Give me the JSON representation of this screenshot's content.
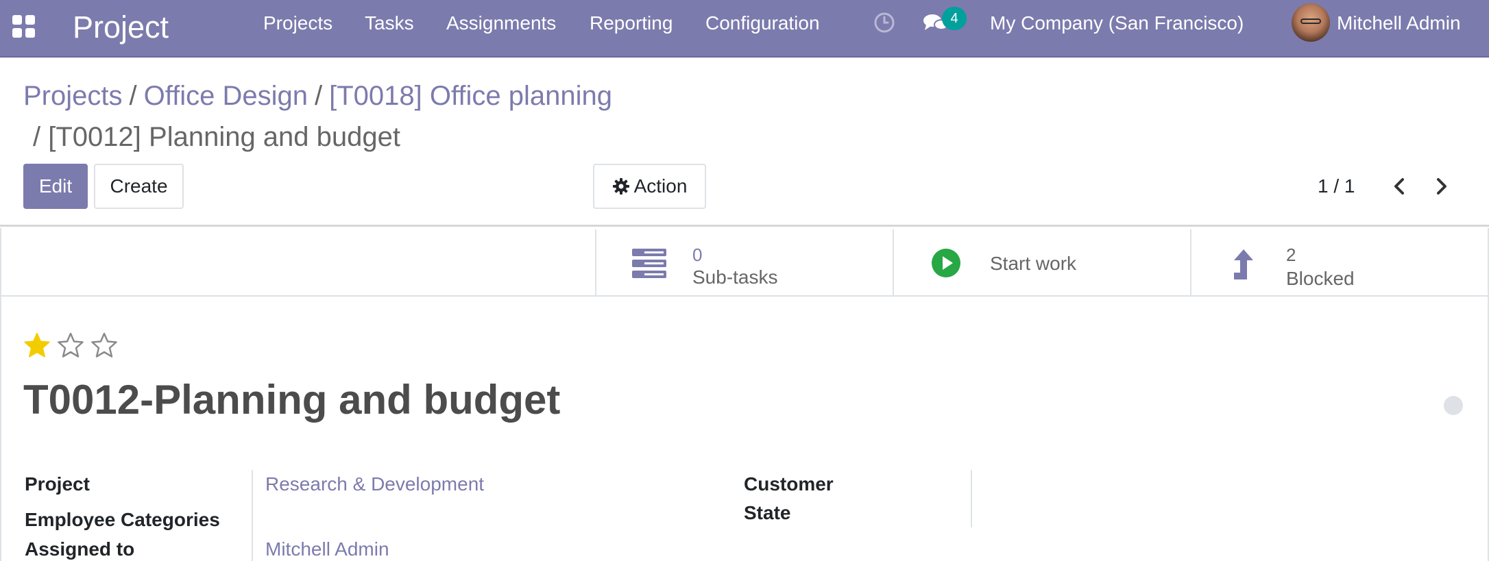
{
  "navbar": {
    "app_title": "Project",
    "menu": [
      "Projects",
      "Tasks",
      "Assignments",
      "Reporting",
      "Configuration"
    ],
    "messages_count": "4",
    "company": "My Company (San Francisco)",
    "user": "Mitchell Admin",
    "icons": [
      "apps-icon",
      "clock-icon",
      "chat-icon"
    ]
  },
  "breadcrumb": {
    "items": [
      "Projects",
      "Office Design",
      "[T0018] Office planning"
    ],
    "separator": "/",
    "current": "[T0012] Planning and budget"
  },
  "buttons": {
    "edit": "Edit",
    "create": "Create",
    "action": "Action"
  },
  "pager": {
    "value": "1 / 1"
  },
  "stat_buttons": {
    "subtasks": {
      "count": "0",
      "label": "Sub-tasks"
    },
    "start_work": {
      "label": "Start work"
    },
    "blocked": {
      "count": "2",
      "label": "Blocked"
    }
  },
  "priority": {
    "rating": 1,
    "max": 5
  },
  "task": {
    "title": "T0012-Planning and budget"
  },
  "fields": {
    "project_label": "Project",
    "project_value": "Research & Development",
    "employee_categories_label": "Employee Categories",
    "assigned_to_label": "Assigned to",
    "assigned_to_value": "Mitchell Admin",
    "customer_label": "Customer",
    "state_label": "State"
  },
  "colors": {
    "brand": "#7c7bad",
    "badge": "#00a09d",
    "star_active": "#f3cc00",
    "start_green": "#28a745"
  }
}
